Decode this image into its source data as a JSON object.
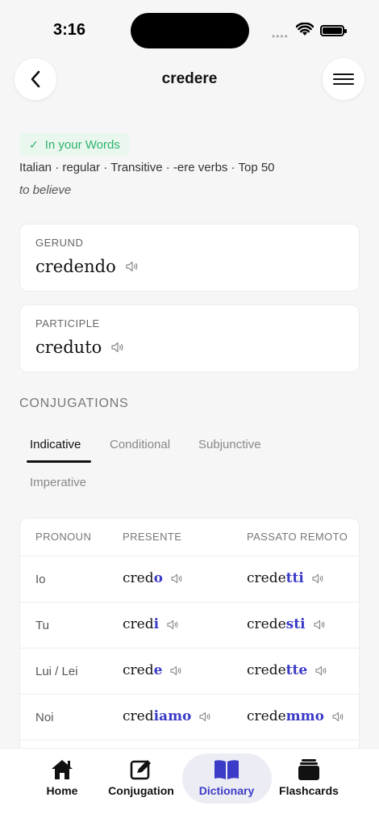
{
  "status": {
    "time": "3:16"
  },
  "header": {
    "title": "credere"
  },
  "meta": {
    "badge": "In your Words",
    "details": "Italian · regular · Transitive · -ere verbs · Top 50",
    "translation": "to believe"
  },
  "forms": {
    "gerund_label": "GERUND",
    "gerund_value": "credendo",
    "participle_label": "PARTICIPLE",
    "participle_value": "creduto"
  },
  "conjugations": {
    "title": "CONJUGATIONS",
    "tabs": [
      "Indicative",
      "Conditional",
      "Subjunctive",
      "Imperative"
    ],
    "active_tab": "Indicative",
    "headers": [
      "PRONOUN",
      "PRESENTE",
      "PASSATO REMOTO"
    ],
    "rows": [
      {
        "pronoun": "Io",
        "presente_stem": "cred",
        "presente_ending": "o",
        "remoto_stem": "crede",
        "remoto_ending": "tti"
      },
      {
        "pronoun": "Tu",
        "presente_stem": "cred",
        "presente_ending": "i",
        "remoto_stem": "crede",
        "remoto_ending": "sti"
      },
      {
        "pronoun": "Lui / Lei",
        "presente_stem": "cred",
        "presente_ending": "e",
        "remoto_stem": "crede",
        "remoto_ending": "tte"
      },
      {
        "pronoun": "Noi",
        "presente_stem": "cred",
        "presente_ending": "iamo",
        "remoto_stem": "crede",
        "remoto_ending": "mmo"
      }
    ]
  },
  "nav": {
    "items": [
      {
        "label": "Home",
        "icon": "home-icon"
      },
      {
        "label": "Conjugation",
        "icon": "edit-icon"
      },
      {
        "label": "Dictionary",
        "icon": "book-icon"
      },
      {
        "label": "Flashcards",
        "icon": "cards-icon"
      }
    ],
    "active": "Dictionary"
  },
  "colors": {
    "accent": "#3b3bc8",
    "success": "#2db36b",
    "background": "#f6f6f6"
  }
}
